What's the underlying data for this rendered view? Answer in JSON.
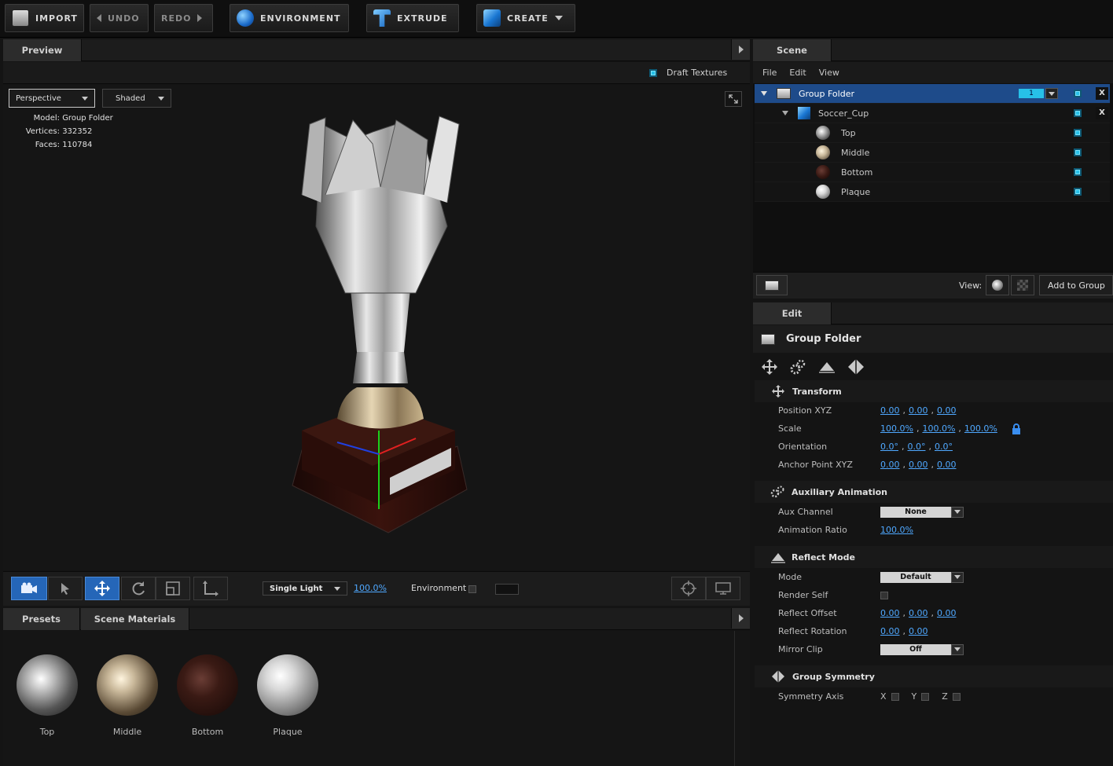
{
  "toolbar": {
    "import": "IMPORT",
    "undo": "UNDO",
    "redo": "REDO",
    "environment": "ENVIRONMENT",
    "extrude": "EXTRUDE",
    "create": "CREATE"
  },
  "preview": {
    "tab": "Preview",
    "draft_textures": "Draft Textures",
    "camera_mode": "Perspective",
    "shading_mode": "Shaded",
    "model_label": "Model:",
    "model_value": "Group Folder",
    "vertices_label": "Vertices:",
    "vertices_value": "332352",
    "faces_label": "Faces:",
    "faces_value": "110784",
    "light_mode": "Single Light",
    "light_percent": "100.0%",
    "environment_label": "Environment"
  },
  "scene": {
    "tab": "Scene",
    "menu": [
      "File",
      "Edit",
      "View"
    ],
    "tree": [
      {
        "label": "Group Folder",
        "level": 0,
        "badge": "1"
      },
      {
        "label": "Soccer_Cup",
        "level": 1
      },
      {
        "label": "Top",
        "level": 2
      },
      {
        "label": "Middle",
        "level": 2
      },
      {
        "label": "Bottom",
        "level": 2
      },
      {
        "label": "Plaque",
        "level": 2
      }
    ],
    "view_label": "View:",
    "add_to_group": "Add to Group"
  },
  "edit": {
    "tab": "Edit",
    "title": "Group Folder",
    "transform": {
      "header": "Transform",
      "position_label": "Position XYZ",
      "position": [
        "0.00",
        "0.00",
        "0.00"
      ],
      "scale_label": "Scale",
      "scale": [
        "100.0%",
        "100.0%",
        "100.0%"
      ],
      "orientation_label": "Orientation",
      "orientation": [
        "0.0°",
        "0.0°",
        "0.0°"
      ],
      "anchor_label": "Anchor Point XYZ",
      "anchor": [
        "0.00",
        "0.00",
        "0.00"
      ]
    },
    "aux": {
      "header": "Auxiliary Animation",
      "channel_label": "Aux Channel",
      "channel_value": "None",
      "ratio_label": "Animation Ratio",
      "ratio_value": "100.0%"
    },
    "reflect": {
      "header": "Reflect Mode",
      "mode_label": "Mode",
      "mode_value": "Default",
      "render_self_label": "Render Self",
      "offset_label": "Reflect Offset",
      "offset": [
        "0.00",
        "0.00",
        "0.00"
      ],
      "rotation_label": "Reflect Rotation",
      "rotation": [
        "0.00",
        "0.00"
      ],
      "mirror_label": "Mirror Clip",
      "mirror_value": "Off"
    },
    "symmetry": {
      "header": "Group Symmetry",
      "axis_label": "Symmetry Axis",
      "axes": [
        "X",
        "Y",
        "Z"
      ]
    }
  },
  "materials": {
    "tabs": [
      "Presets",
      "Scene Materials"
    ],
    "items": [
      {
        "label": "Top",
        "color": "#c8c8c8"
      },
      {
        "label": "Middle",
        "color": "#c9b89a"
      },
      {
        "label": "Bottom",
        "color": "#3a1a14"
      },
      {
        "label": "Plaque",
        "color": "#d9d9d9"
      }
    ]
  },
  "colors": {
    "accent": "#27c0e8",
    "selection": "#1e4b8a",
    "link": "#4fa8ff"
  }
}
